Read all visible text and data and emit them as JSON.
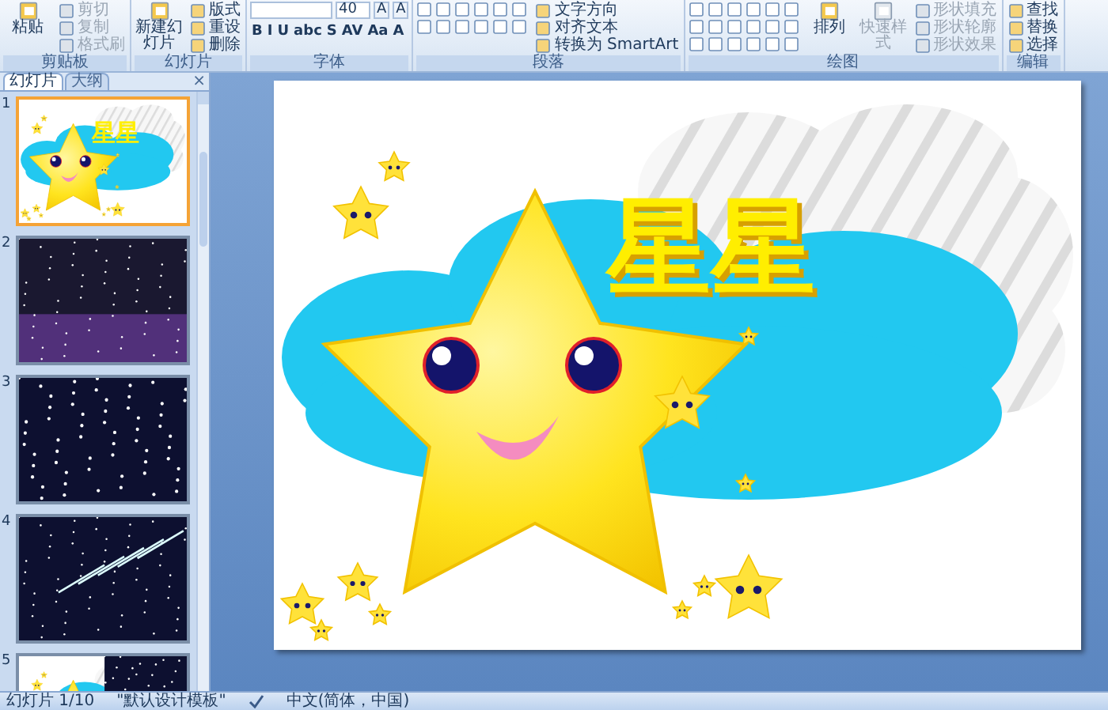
{
  "ribbon": {
    "groups": [
      {
        "label": "剪贴板",
        "kind": "standard",
        "large": [
          {
            "label": "粘贴",
            "disabled": false
          }
        ],
        "small": [
          {
            "label": "剪切",
            "disabled": true
          },
          {
            "label": "复制",
            "disabled": true
          },
          {
            "label": "格式刷",
            "disabled": true
          }
        ]
      },
      {
        "label": "幻灯片",
        "kind": "standard",
        "large": [
          {
            "label": "新建幻灯片",
            "disabled": false
          }
        ],
        "small": [
          {
            "label": "版式",
            "disabled": false
          },
          {
            "label": "重设",
            "disabled": false
          },
          {
            "label": "删除",
            "disabled": false
          }
        ]
      },
      {
        "label": "字体",
        "kind": "font",
        "font_size": "40",
        "size_buttons": [
          "A",
          "A"
        ],
        "format_buttons": [
          "B",
          "I",
          "U",
          "abc",
          "S",
          "AV",
          "Aa",
          "A"
        ]
      },
      {
        "label": "段落",
        "kind": "paragraph",
        "small": [
          {
            "label": "文字方向",
            "disabled": false
          },
          {
            "label": "对齐文本",
            "disabled": false
          },
          {
            "label": "转换为 SmartArt",
            "disabled": false
          }
        ]
      },
      {
        "label": "绘图",
        "kind": "drawing",
        "large": [
          {
            "label": "排列",
            "disabled": false
          },
          {
            "label": "快速样式",
            "disabled": true
          }
        ],
        "small": [
          {
            "label": "形状填充",
            "disabled": true
          },
          {
            "label": "形状轮廓",
            "disabled": true
          },
          {
            "label": "形状效果",
            "disabled": true
          }
        ]
      },
      {
        "label": "编辑",
        "kind": "standard",
        "small": [
          {
            "label": "查找",
            "disabled": false
          },
          {
            "label": "替换",
            "disabled": false
          },
          {
            "label": "选择",
            "disabled": false
          }
        ]
      }
    ]
  },
  "pane": {
    "tabs": [
      {
        "label": "幻灯片",
        "selected": true
      },
      {
        "label": "大纲",
        "selected": false
      }
    ],
    "close": "×",
    "thumbnails": [
      {
        "number": "1",
        "selected": true,
        "kind": "title",
        "title": "星星"
      },
      {
        "number": "2",
        "selected": false,
        "kind": "starfield"
      },
      {
        "number": "3",
        "selected": false,
        "kind": "galaxy"
      },
      {
        "number": "4",
        "selected": false,
        "kind": "meteor"
      },
      {
        "number": "5",
        "selected": false,
        "kind": "split"
      }
    ]
  },
  "slide": {
    "title": "星星"
  },
  "status_bar": {
    "items": [
      "幻灯片 1/10",
      "\"默认设计模板\"",
      "中文(简体，中国)"
    ]
  }
}
